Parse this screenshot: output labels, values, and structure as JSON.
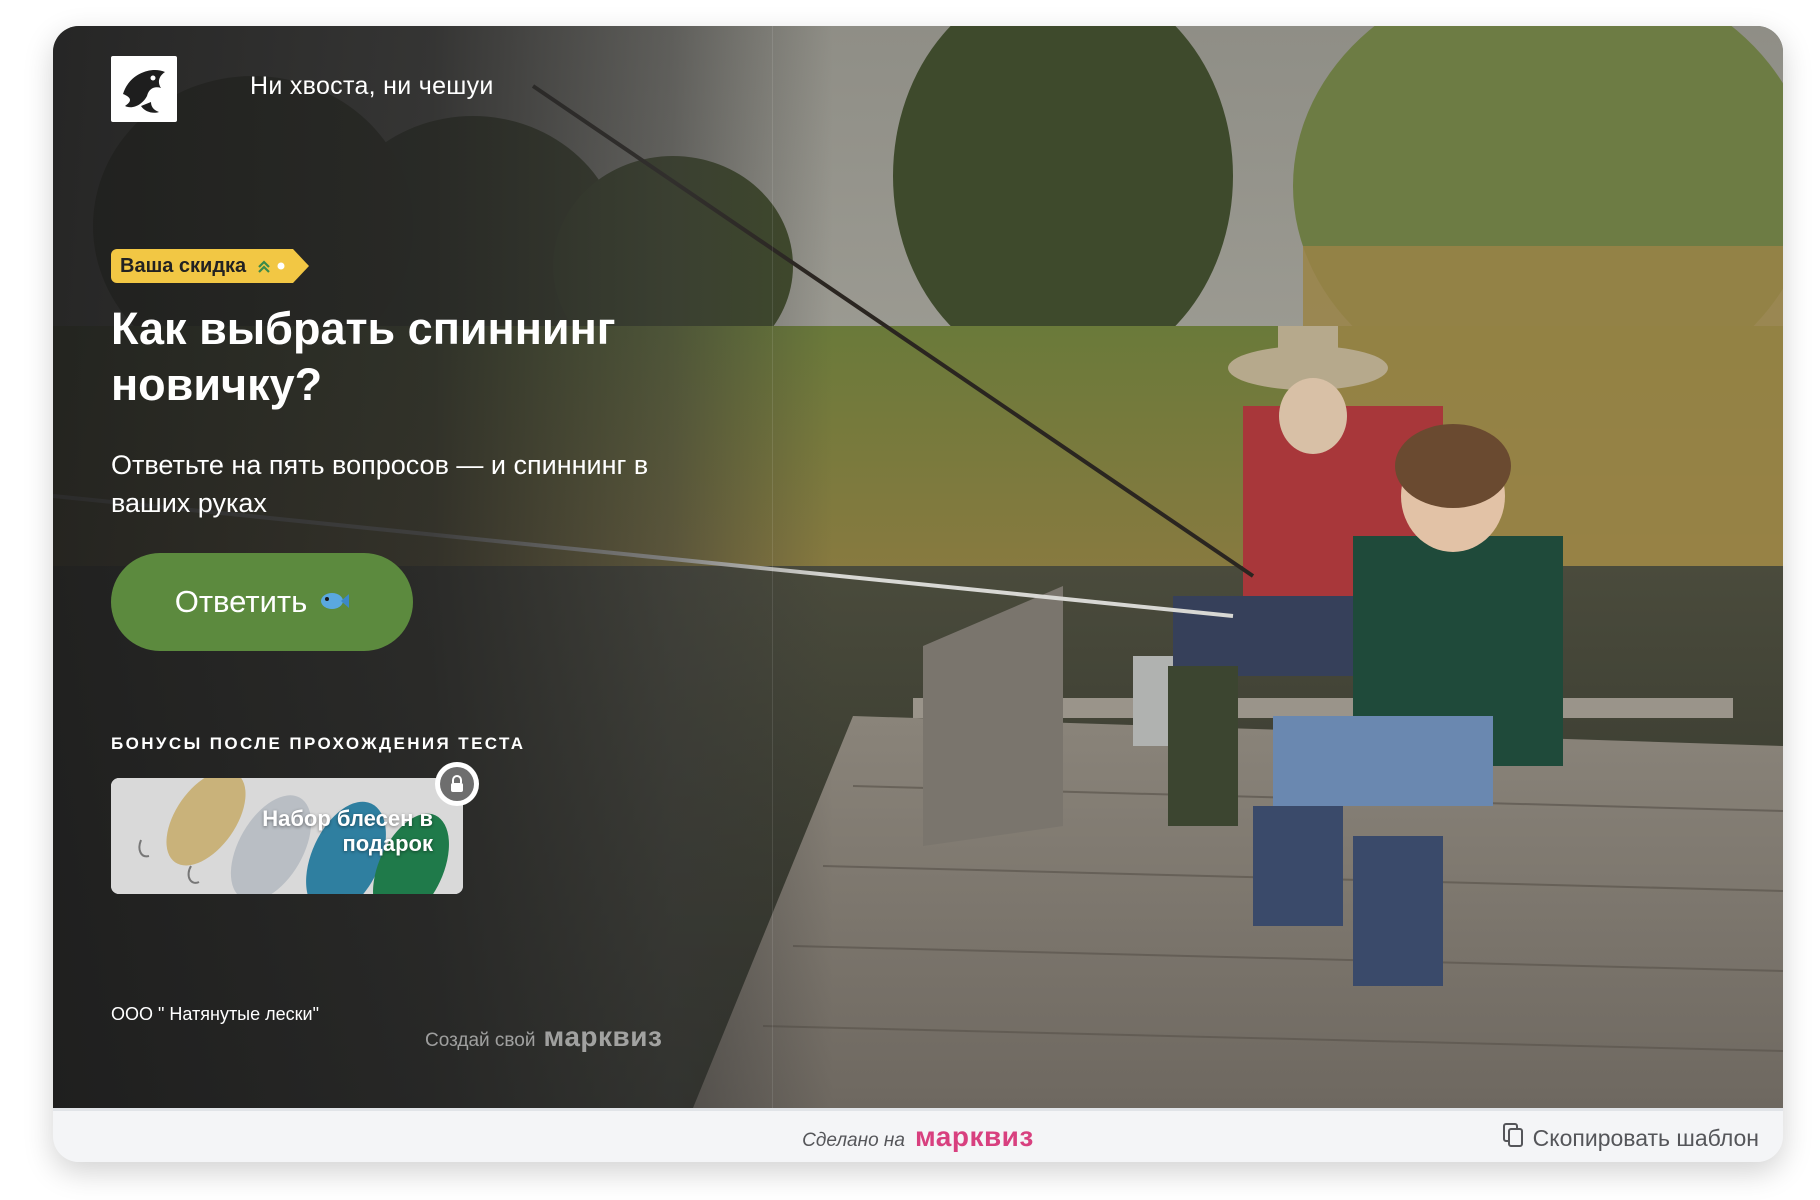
{
  "header": {
    "brand_name": "Ни хвоста, ни чешуи",
    "logo_icon": "fish-logo-icon"
  },
  "hero": {
    "discount_badge": "Ваша скидка",
    "headline": "Как выбрать спиннинг новичку?",
    "subtitle": "Ответьте на пять вопросов — и спиннинг в ваших руках",
    "answer_button": "Ответить",
    "answer_button_icon": "fish-emoji-icon",
    "bonus_title": "БОНУСЫ ПОСЛЕ ПРОХОЖДЕНИЯ ТЕСТА",
    "bonus_item": "Набор блесен в подарок",
    "bonus_lock_icon": "lock-icon",
    "company": "ООО \" Натянутые лески\"",
    "powered_prefix": "Создай свой",
    "powered_brand": "марквиз"
  },
  "footer": {
    "made_on_text": "Сделано на",
    "made_on_brand": "марквиз",
    "copy_template": "Скопировать шаблон",
    "copy_icon": "copy-icon"
  },
  "colors": {
    "accent_green": "#5c8a3e",
    "badge_yellow": "#f2c744",
    "brand_pink": "#d8407f"
  }
}
